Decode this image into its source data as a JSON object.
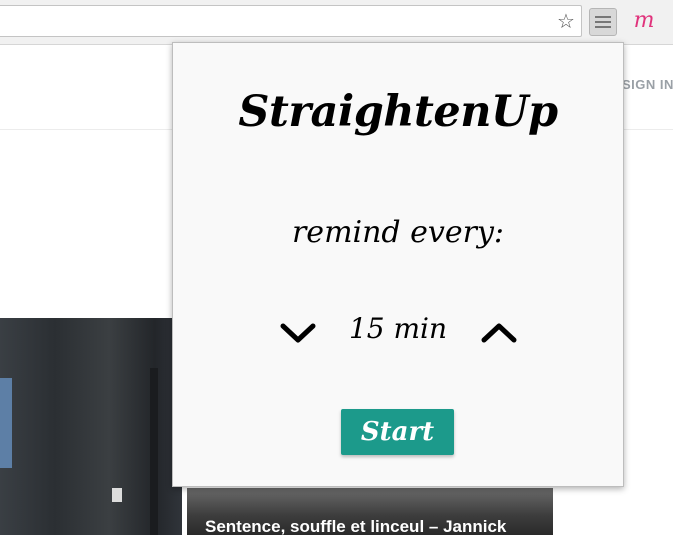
{
  "browser": {
    "bookmark_icon": "star-icon",
    "extensions": [
      {
        "icon": "straightenup-extension-icon"
      },
      {
        "icon": "m-extension-icon",
        "glyph": "m",
        "color": "#e0337c"
      }
    ]
  },
  "page": {
    "signin_label": "SIGN IN",
    "article_caption": "Sentence, souffle et linceul – Jannick"
  },
  "popup": {
    "title": "StraightenUp",
    "subtitle": "remind every:",
    "decrease_icon": "chevron-down-icon",
    "increase_icon": "chevron-up-icon",
    "duration_label": "15 min",
    "start_label": "Start",
    "accent_color": "#1c9a8b"
  }
}
